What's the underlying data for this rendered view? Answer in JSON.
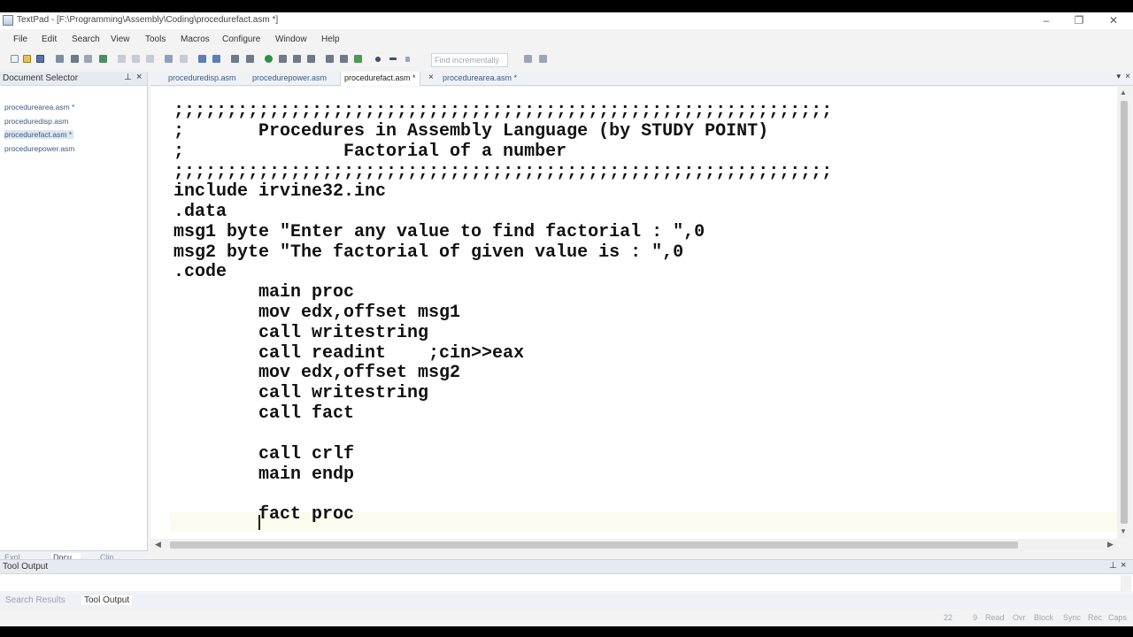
{
  "window": {
    "title": "TextPad - [F:\\Programming\\Assembly\\Coding\\procedurefact.asm *]",
    "minimize": "–",
    "maximize": "❐",
    "close": "✕"
  },
  "menu": [
    "File",
    "Edit",
    "Search",
    "View",
    "Tools",
    "Macros",
    "Configure",
    "Window",
    "Help"
  ],
  "toolbar": {
    "find_placeholder": "Find incrementally"
  },
  "document_selector": {
    "title": "Document Selector",
    "pin": "⊥",
    "close": "×",
    "files": [
      "procedurearea.asm *",
      "proceduredisp.asm",
      "procedurefact.asm *",
      "procedurepower.asm"
    ],
    "selected_index": 2,
    "tabs": [
      "Expl...",
      "Docu...",
      "Clip..."
    ],
    "active_tab": 1
  },
  "file_tabs": {
    "tabs": [
      "proceduredisp.asm",
      "procedurepower.asm",
      "procedurefact.asm *",
      "procedurearea.asm *"
    ],
    "active_index": 2,
    "close_glyph": "×",
    "menu_glyph": "▾",
    "close_all_glyph": "×"
  },
  "editor": {
    "lines": [
      ";;;;;;;;;;;;;;;;;;;;;;;;;;;;;;;;;;;;;;;;;;;;;;;;;;;;;;;;;;;;;;",
      ";       Procedures in Assembly Language (by STUDY POINT)",
      ";               Factorial of a number",
      ";;;;;;;;;;;;;;;;;;;;;;;;;;;;;;;;;;;;;;;;;;;;;;;;;;;;;;;;;;;;;;",
      "include irvine32.inc",
      ".data",
      "msg1 byte \"Enter any value to find factorial : \",0",
      "msg2 byte \"The factorial of given value is : \",0",
      ".code",
      "        main proc",
      "        mov edx,offset msg1",
      "        call writestring",
      "        call readint    ;cin>>eax",
      "        mov edx,offset msg2",
      "        call writestring",
      "        call fact",
      "",
      "        call crlf",
      "        main endp",
      "",
      "        fact proc"
    ]
  },
  "tool_output": {
    "title": "Tool Output",
    "pin": "⊥",
    "close": "×",
    "tabs": [
      "Search Results",
      "Tool Output"
    ],
    "active_tab": 1
  },
  "status_bar": {
    "line": "22",
    "column": "9",
    "flags": [
      "Read",
      "Ovr",
      "Block",
      "Sync",
      "Rec",
      "Caps"
    ]
  }
}
